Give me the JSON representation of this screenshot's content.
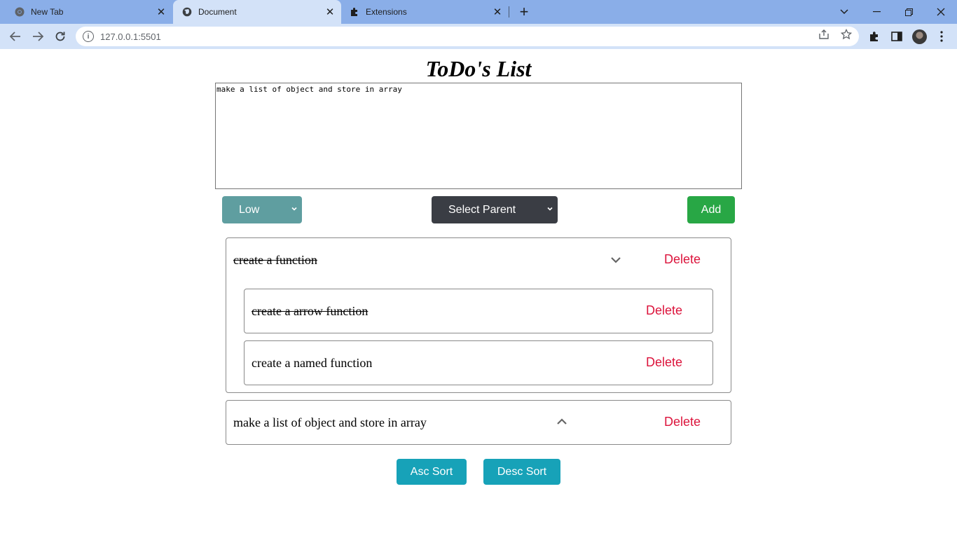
{
  "browser": {
    "tabs": [
      {
        "title": "New Tab",
        "icon": "chrome-icon",
        "active": false
      },
      {
        "title": "Document",
        "icon": "globe-icon",
        "active": true
      },
      {
        "title": "Extensions",
        "icon": "puzzle-icon",
        "active": false
      }
    ],
    "url": "127.0.0.1:5501"
  },
  "app": {
    "title": "ToDo's List",
    "textarea_value": "make a list of object and store in array",
    "priority_select": {
      "selected": "Low"
    },
    "parent_select": {
      "selected": "Select Parent"
    },
    "add_label": "Add",
    "delete_label": "Delete",
    "todos": [
      {
        "text": "create a function",
        "completed": true,
        "expanded": true,
        "children": [
          {
            "text": "create a arrow function",
            "completed": true
          },
          {
            "text": "create a named function",
            "completed": false
          }
        ]
      },
      {
        "text": "make a list of object and store in array",
        "completed": false,
        "expanded": false,
        "children": []
      }
    ],
    "asc_sort_label": "Asc Sort",
    "desc_sort_label": "Desc Sort"
  },
  "colors": {
    "priority_bg": "#5f9ea0",
    "parent_bg": "#3a3d44",
    "add_bg": "#28a745",
    "delete_text": "#dc143c",
    "sort_bg": "#17a2b8"
  }
}
